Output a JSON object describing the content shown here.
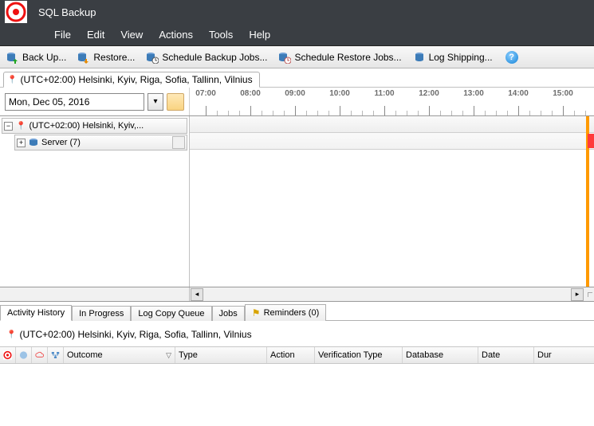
{
  "app": {
    "title": "SQL Backup"
  },
  "menu": {
    "file": "File",
    "edit": "Edit",
    "view": "View",
    "actions": "Actions",
    "tools": "Tools",
    "help": "Help"
  },
  "toolbar": {
    "backup": "Back Up...",
    "restore": "Restore...",
    "scheduleBackup": "Schedule Backup Jobs...",
    "scheduleRestore": "Schedule Restore Jobs...",
    "logShipping": "Log Shipping..."
  },
  "timezone": {
    "tabLabel": "(UTC+02:00) Helsinki, Kyiv, Riga, Sofia, Tallinn, Vilnius",
    "shortLabel": "(UTC+02:00) Helsinki, Kyiv,..."
  },
  "date": {
    "value": "Mon, Dec 05, 2016"
  },
  "ruler": {
    "hours": [
      "07:00",
      "08:00",
      "09:00",
      "10:00",
      "11:00",
      "12:00",
      "13:00",
      "14:00",
      "15:00"
    ]
  },
  "tree": {
    "server": "Server (7)"
  },
  "bottomTabs": {
    "activity": "Activity History",
    "inProgress": "In Progress",
    "logCopy": "Log Copy Queue",
    "jobs": "Jobs",
    "reminders": "Reminders (0)"
  },
  "grid": {
    "outcome": "Outcome",
    "type": "Type",
    "action": "Action",
    "verif": "Verification Type",
    "database": "Database",
    "date": "Date",
    "dur": "Dur"
  }
}
